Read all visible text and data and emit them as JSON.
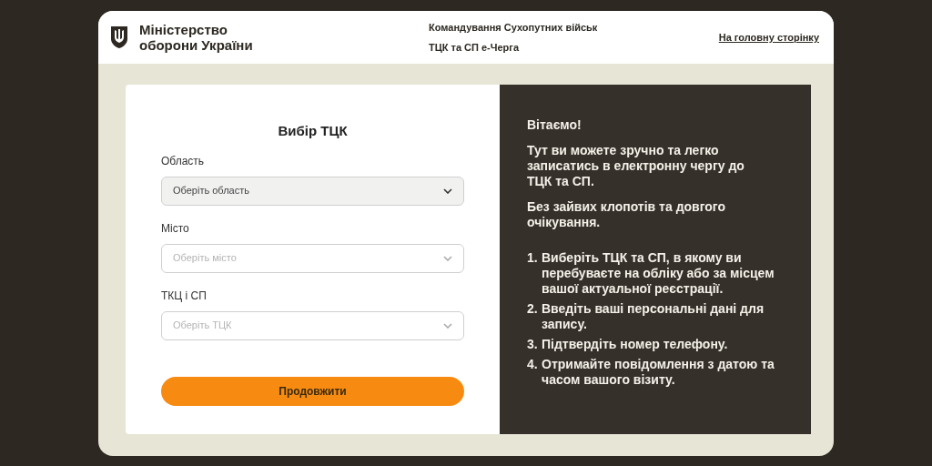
{
  "header": {
    "ministry": "Міністерство оборони України",
    "subtitle_1": "Командування Сухопутних військ",
    "subtitle_2": "ТЦК та СП е-Черга",
    "home_link": "На головну сторінку"
  },
  "form": {
    "title": "Вибір ТЦК",
    "fields": [
      {
        "label": "Область",
        "placeholder": "Оберіть область",
        "disabled": false
      },
      {
        "label": "Місто",
        "placeholder": "Оберіть місто",
        "disabled": true
      },
      {
        "label": "ТКЦ і СП",
        "placeholder": "Оберіть ТЦК",
        "disabled": true
      }
    ],
    "submit": "Продовжити"
  },
  "info": {
    "greeting": "Вітаємо!",
    "paragraphs": [
      "Тут ви можете зручно та легко записатись в електронну чергу до ТЦК та СП.",
      "Без зайвих клопотів та довгого очікування."
    ],
    "steps": [
      {
        "number": "1.",
        "text": "Виберіть ТЦК та СП, в якому ви перебуваєте на обліку або за місцем вашої актуальної реєстрації."
      },
      {
        "number": "2.",
        "text": "Введіть ваші персональні дані для запису."
      },
      {
        "number": "3.",
        "text": "Підтвердіть номер телефону."
      },
      {
        "number": "4.",
        "text": "Отримайте повідомлення з датою та часом вашого візиту."
      }
    ]
  }
}
